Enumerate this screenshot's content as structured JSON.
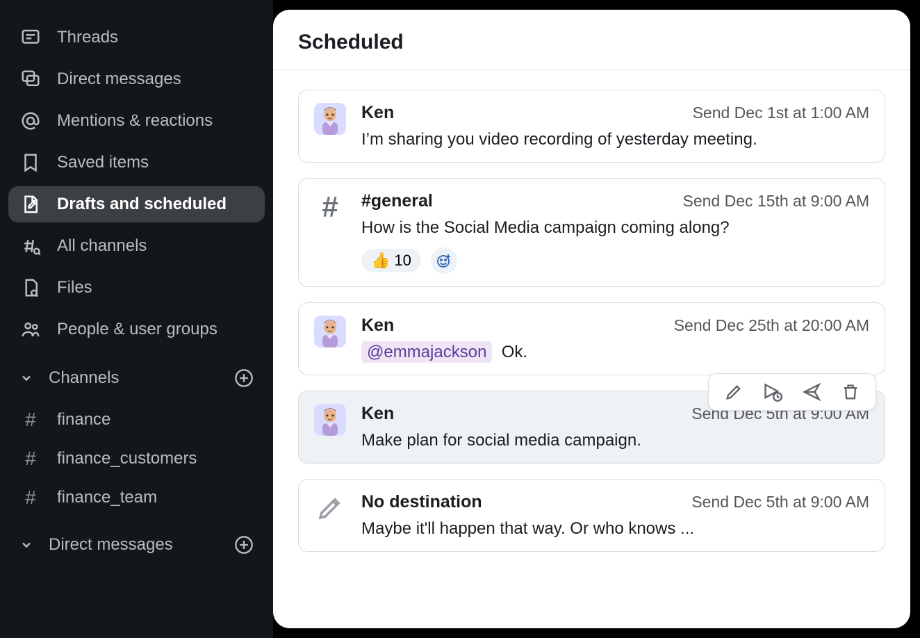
{
  "sidebar": {
    "items": [
      {
        "id": "threads",
        "label": "Threads"
      },
      {
        "id": "dms",
        "label": "Direct messages"
      },
      {
        "id": "mentions",
        "label": "Mentions & reactions"
      },
      {
        "id": "saved",
        "label": "Saved items"
      },
      {
        "id": "drafts",
        "label": "Drafts and scheduled"
      },
      {
        "id": "all-channels",
        "label": "All channels"
      },
      {
        "id": "files",
        "label": "Files"
      },
      {
        "id": "people",
        "label": "People & user groups"
      }
    ],
    "channels_header": "Channels",
    "channels": [
      {
        "name": "finance"
      },
      {
        "name": "finance_customers"
      },
      {
        "name": "finance_team"
      }
    ],
    "dm_header": "Direct messages"
  },
  "main": {
    "title": "Scheduled",
    "messages": [
      {
        "avatar": "user",
        "sender": "Ken",
        "time": "Send Dec 1st at 1:00 AM",
        "body": "I’m sharing you video recording of yesterday meeting."
      },
      {
        "avatar": "general",
        "sender": "#general",
        "time": "Send Dec 15th at 9:00 AM",
        "body": "How is the Social Media campaign coming along?",
        "reactions": [
          {
            "emoji": "👍",
            "count": 10
          }
        ]
      },
      {
        "avatar": "user",
        "sender": "Ken",
        "time": "Send Dec 25th at 20:00 AM",
        "mention": "@emmajackson",
        "body": "Ok."
      },
      {
        "avatar": "user",
        "sender": "Ken",
        "time": "Send Dec 5th at 9:00 AM",
        "body": "Make plan for social media campaign.",
        "hovered": true,
        "toolbar": true
      },
      {
        "avatar": "draft",
        "sender": "No destination",
        "time": "Send Dec 5th at 9:00 AM",
        "body": "Maybe it'll happen that way. Or who knows ..."
      }
    ]
  }
}
